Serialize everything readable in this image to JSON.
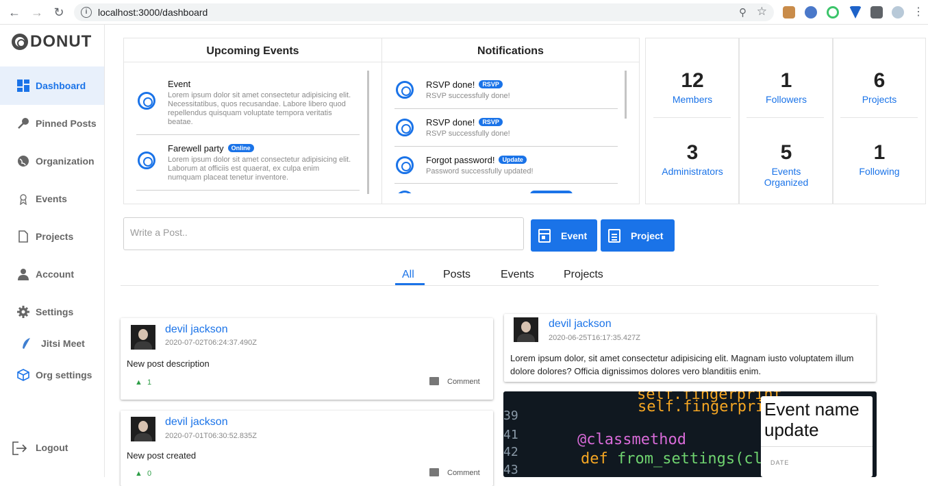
{
  "browser": {
    "url": "localhost:3000/dashboard"
  },
  "sidebar": {
    "brand": "DONUT",
    "items": [
      {
        "label": "Dashboard"
      },
      {
        "label": "Pinned Posts"
      },
      {
        "label": "Organization"
      },
      {
        "label": "Events"
      },
      {
        "label": "Projects"
      },
      {
        "label": "Account"
      },
      {
        "label": "Settings"
      },
      {
        "label": "Jitsi Meet"
      },
      {
        "label": "Org settings"
      }
    ],
    "logout": "Logout"
  },
  "upcoming": {
    "title": "Upcoming Events",
    "items": [
      {
        "title": "Event",
        "badge": "",
        "desc": "Lorem ipsum dolor sit amet consectetur adipisicing elit. Necessitatibus, quos recusandae. Labore libero quod repellendus quisquam voluptate tempora veritatis beatae."
      },
      {
        "title": "Farewell party",
        "badge": "Online",
        "desc": "Lorem ipsum dolor sit amet consectetur adipisicing elit. Laborum at officiis est quaerat, ex culpa enim numquam placeat tenetur inventore."
      }
    ]
  },
  "notifications": {
    "title": "Notifications",
    "items": [
      {
        "title": "RSVP done!",
        "badge": "RSVP",
        "desc": "RSVP successfully done!"
      },
      {
        "title": "RSVP done!",
        "badge": "RSVP",
        "desc": "RSVP successfully done!"
      },
      {
        "title": "Forgot password!",
        "badge": "Update",
        "desc": "Password successfully updated!"
      }
    ]
  },
  "stats": [
    {
      "value": "12",
      "label": "Members"
    },
    {
      "value": "1",
      "label": "Followers"
    },
    {
      "value": "6",
      "label": "Projects"
    },
    {
      "value": "3",
      "label": "Administrators"
    },
    {
      "value": "5",
      "label": "Events Organized"
    },
    {
      "value": "1",
      "label": "Following"
    }
  ],
  "composer": {
    "placeholder": "Write a Post..",
    "event_btn": "Event",
    "project_btn": "Project"
  },
  "tabs": [
    "All",
    "Posts",
    "Events",
    "Projects"
  ],
  "posts": [
    {
      "author": "devil jackson",
      "time": "2020-07-02T06:24:37.490Z",
      "text": "New post description",
      "likes": "1",
      "comment": "Comment"
    },
    {
      "author": "devil jackson",
      "time": "2020-07-01T06:30:52.835Z",
      "text": "New post created",
      "likes": "0",
      "comment": "Comment"
    },
    {
      "author": "devil jackson",
      "time": "2020-06-25T16:17:35.427Z",
      "text": "Lorem ipsum dolor, sit amet consectetur adipisicing elit. Magnam iusto voluptatem illum dolore dolores? Officia dignissimos dolores vero blanditiis enim."
    }
  ],
  "event_card": {
    "name": "Event name update",
    "date_label": "DATE"
  },
  "colors": {
    "accent": "#1a73e8",
    "active_bg": "#e8f0fb",
    "likes": "#2e9e47"
  }
}
